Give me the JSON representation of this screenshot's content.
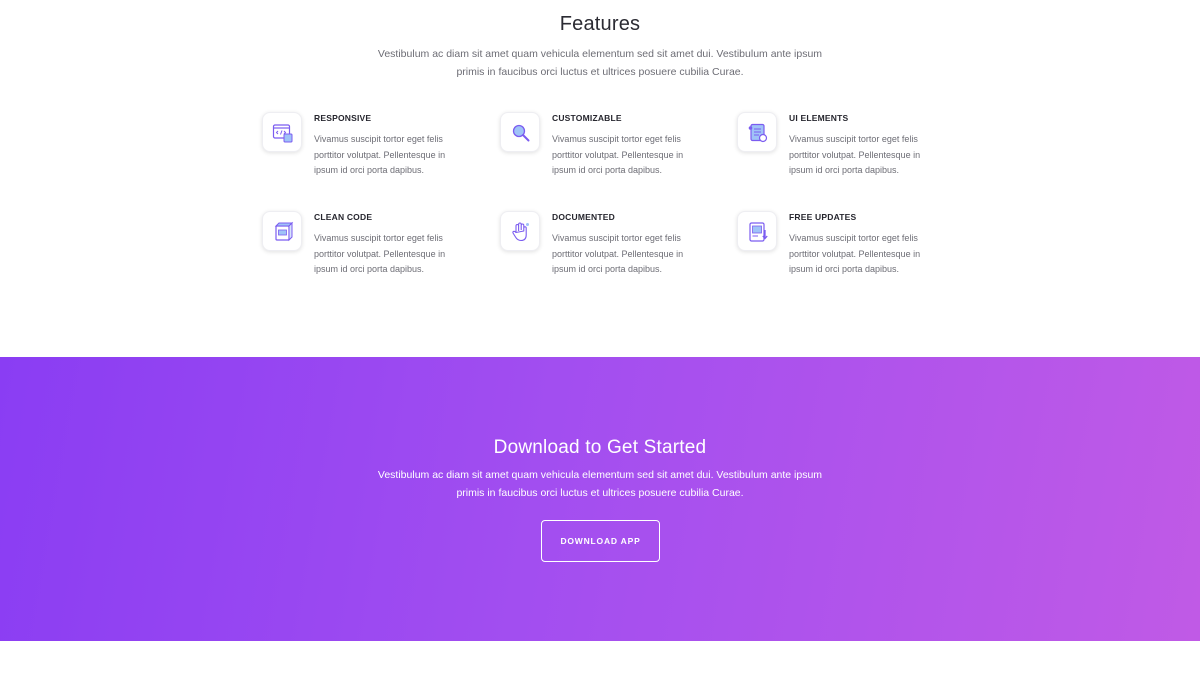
{
  "features": {
    "title": "Features",
    "subtitle": "Vestibulum ac diam sit amet quam vehicula elementum sed sit amet dui. Vestibulum ante ipsum primis in faucibus orci luctus et ultrices posuere cubilia Curae.",
    "items": [
      {
        "title": "RESPONSIVE",
        "text": "Vivamus suscipit tortor eget felis porttitor volutpat. Pellentesque in ipsum id orci porta dapibus.",
        "icon": "code-window-icon"
      },
      {
        "title": "CUSTOMIZABLE",
        "text": "Vivamus suscipit tortor eget felis porttitor volutpat. Pellentesque in ipsum id orci porta dapibus.",
        "icon": "magnifier-icon"
      },
      {
        "title": "UI ELEMENTS",
        "text": "Vivamus suscipit tortor eget felis porttitor volutpat. Pellentesque in ipsum id orci porta dapibus.",
        "icon": "ui-elements-icon"
      },
      {
        "title": "CLEAN CODE",
        "text": "Vivamus suscipit tortor eget felis porttitor volutpat. Pellentesque in ipsum id orci porta dapibus.",
        "icon": "box-icon"
      },
      {
        "title": "DOCUMENTED",
        "text": "Vivamus suscipit tortor eget felis porttitor volutpat. Pellentesque in ipsum id orci porta dapibus.",
        "icon": "hand-icon"
      },
      {
        "title": "FREE UPDATES",
        "text": "Vivamus suscipit tortor eget felis porttitor volutpat. Pellentesque in ipsum id orci porta dapibus.",
        "icon": "document-download-icon"
      }
    ]
  },
  "cta": {
    "title": "Download to Get Started",
    "subtitle": "Vestibulum ac diam sit amet quam vehicula elementum sed sit amet dui. Vestibulum ante ipsum primis in faucibus orci luctus et ultrices posuere cubilia Curae.",
    "button_label": "DOWNLOAD APP"
  },
  "colors": {
    "accent_purple": "#8a3df3",
    "accent_pink": "#c05ae6",
    "icon_stroke": "#7b5cf0",
    "icon_fill": "#9fc3f7"
  }
}
